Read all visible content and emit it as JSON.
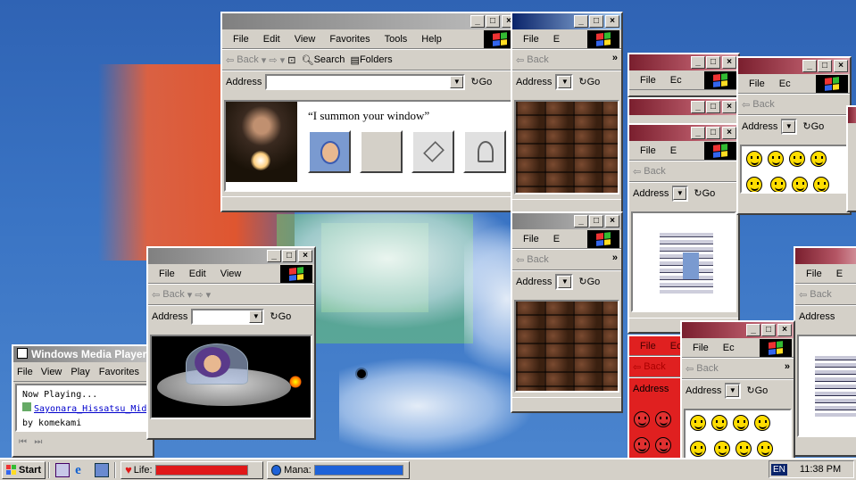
{
  "colors": {
    "accent": "#0a246a",
    "life": "#e01818",
    "mana": "#1e62d8",
    "smiley": "#ffdd00"
  },
  "main_window": {
    "menu": [
      "File",
      "Edit",
      "View",
      "Favorites",
      "Tools",
      "Help"
    ],
    "nav": {
      "back": "Back",
      "search": "Search",
      "folders": "Folders"
    },
    "address_label": "Address",
    "go": "Go",
    "caption": "“I summon your window”"
  },
  "brick_windows": {
    "menu": [
      "File",
      "E"
    ],
    "back": "Back",
    "address_label": "Address",
    "go": "Go"
  },
  "small_windows": {
    "menu_ec": [
      "File",
      "Ec"
    ],
    "menu_e": [
      "File",
      "E"
    ],
    "back": "Back",
    "address_label": "Address",
    "go": "Go"
  },
  "ufo_window": {
    "menu": [
      "File",
      "Edit",
      "View"
    ],
    "back": "Back",
    "address_label": "Address",
    "go": "Go"
  },
  "media_player": {
    "title": "Windows Media Player",
    "menu": [
      "File",
      "View",
      "Play",
      "Favorites"
    ],
    "now_playing": "Now Playing...",
    "track": "Sayonara_Hissatsu_Midn",
    "artist": "by komekami"
  },
  "taskbar": {
    "start": "Start",
    "life_label": "Life:",
    "life_value": 1.0,
    "mana_label": "Mana:",
    "mana_value": 1.0,
    "lang": "EN",
    "clock": "11:38 PM"
  }
}
